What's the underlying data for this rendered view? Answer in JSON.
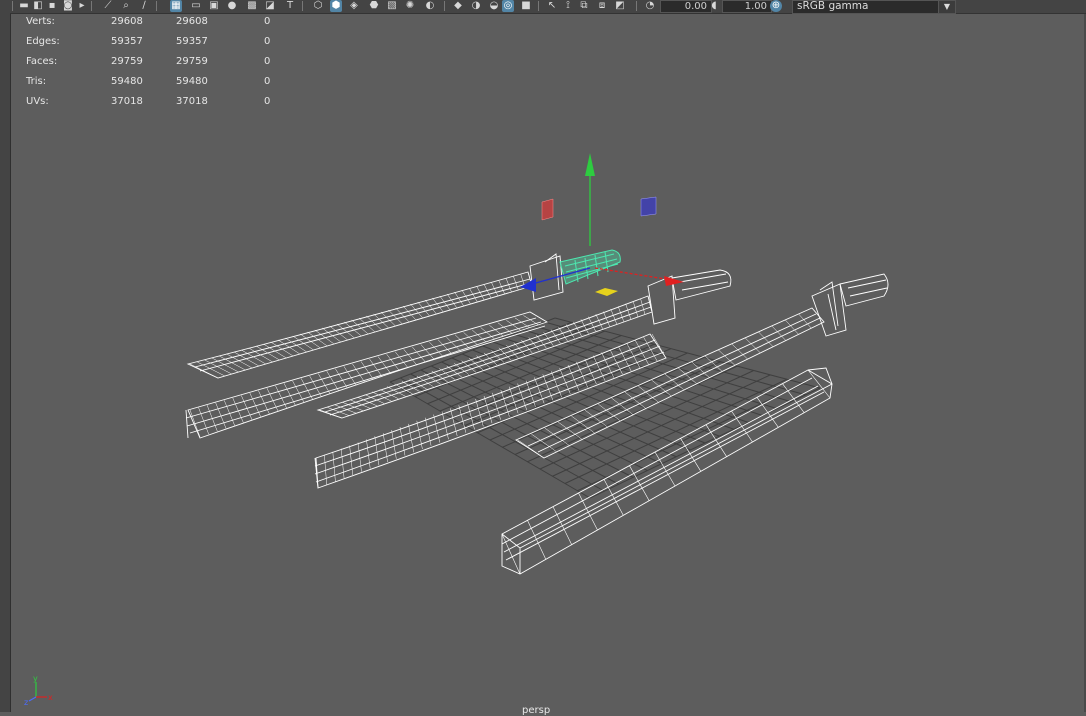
{
  "toolbar": {
    "exposure_value": "0.00",
    "gamma_value": "1.00",
    "color_space": "sRGB gamma",
    "icons": [
      "camera-icon",
      "camera-attr-icon",
      "bookmark-icon",
      "image-plane-icon",
      "grease-pencil-icon",
      "2d-pan-icon",
      "isolate-icon",
      "grid-icon",
      "film-gate-icon",
      "resolution-gate-icon",
      "gate-mask-icon",
      "field-chart-icon",
      "safe-action-icon",
      "safe-title-icon",
      "wireframe-icon",
      "smooth-shade-icon",
      "shade-wire-icon",
      "default-material-icon",
      "textured-icon",
      "lights-icon",
      "shadows-icon",
      "screen-ao-icon",
      "motion-blur-icon",
      "antialias-icon",
      "dof-icon",
      "isolate-select-icon",
      "xray-icon",
      "xray-joints-icon",
      "xray-components-icon",
      "exposure-icon",
      "gamma-icon",
      "color-management-icon"
    ]
  },
  "hud": {
    "rows": [
      {
        "label": "Verts:",
        "v1": "29608",
        "v2": "29608",
        "v3": "0"
      },
      {
        "label": "Edges:",
        "v1": "59357",
        "v2": "59357",
        "v3": "0"
      },
      {
        "label": "Faces:",
        "v1": "29759",
        "v2": "29759",
        "v3": "0"
      },
      {
        "label": "Tris:",
        "v1": "59480",
        "v2": "59480",
        "v3": "0"
      },
      {
        "label": "UVs:",
        "v1": "37018",
        "v2": "37018",
        "v3": "0"
      }
    ]
  },
  "viewport": {
    "camera_name": "persp",
    "axis_labels": {
      "x": "x",
      "y": "y",
      "z": "z"
    },
    "colors": {
      "background": "#5d5d5d",
      "wire": "#ffffff",
      "selected": "#4de8b0",
      "grid": "#3f3f3f",
      "move_y": "#2ecc40",
      "move_x": "#e02020",
      "move_z": "#2030d0",
      "plane_center": "#e6d21c"
    }
  }
}
